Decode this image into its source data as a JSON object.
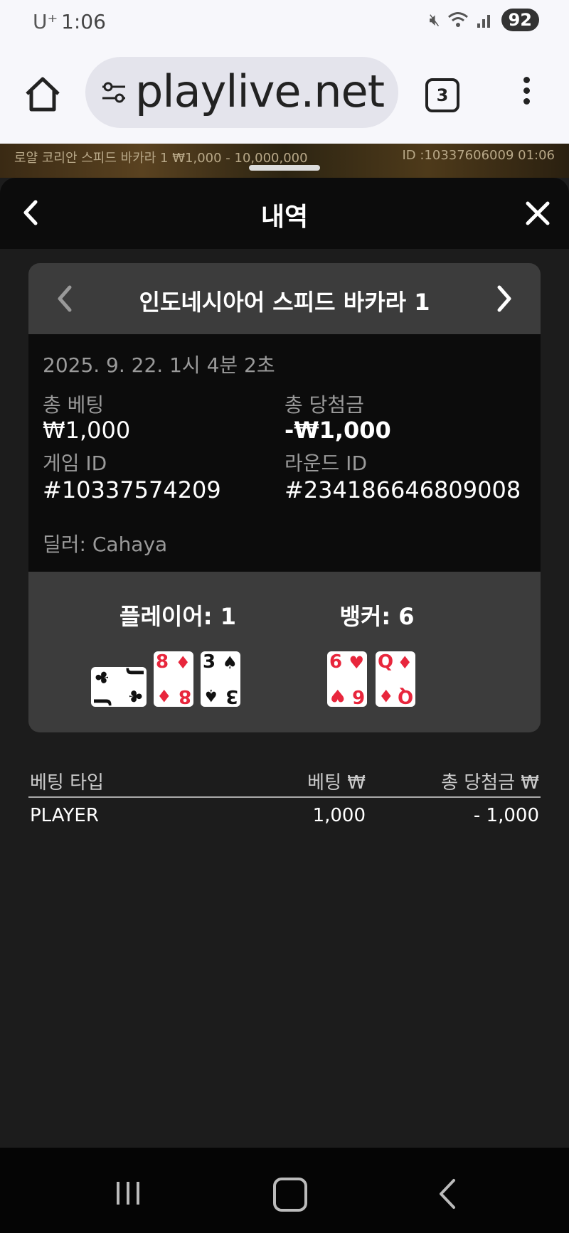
{
  "status": {
    "carrier": "U⁺",
    "time": "1:06",
    "battery": "92"
  },
  "browser": {
    "url": "playlive.net",
    "tab_count": "3"
  },
  "game_strip": {
    "left_text": "로얄 코리안 스피드 바카라 1 ₩1,000 - 10,000,000",
    "right_text": "ID :10337606009 01:06"
  },
  "sheet": {
    "title": "내역"
  },
  "game": {
    "name": "인도네시아어 스피드 바카라 1",
    "datetime": "2025. 9. 22. 1시 4분 2초",
    "total_bet_label": "총 베팅",
    "total_bet_value": "₩1,000",
    "total_win_label": "총 당첨금",
    "total_win_value": "-₩1,000",
    "game_id_label": "게임 ID",
    "game_id_value": "#10337574209",
    "round_id_label": "라운드 ID",
    "round_id_value": "#234186646809008",
    "dealer": "딜러: Cahaya"
  },
  "result": {
    "player_label": "플레이어: 1",
    "banker_label": "뱅커: 6",
    "player_cards": [
      {
        "rank": "J",
        "suit": "♣",
        "color": "black",
        "sideways": true
      },
      {
        "rank": "8",
        "suit": "♦",
        "color": "red"
      },
      {
        "rank": "3",
        "suit": "♠",
        "color": "black"
      }
    ],
    "banker_cards": [
      {
        "rank": "6",
        "suit": "♥",
        "color": "red"
      },
      {
        "rank": "Q",
        "suit": "♦",
        "color": "red"
      }
    ]
  },
  "bets": {
    "headers": [
      "베팅 타입",
      "베팅 ₩",
      "총 당첨금 ₩"
    ],
    "rows": [
      [
        "PLAYER",
        "1,000",
        "- 1,000"
      ]
    ]
  }
}
